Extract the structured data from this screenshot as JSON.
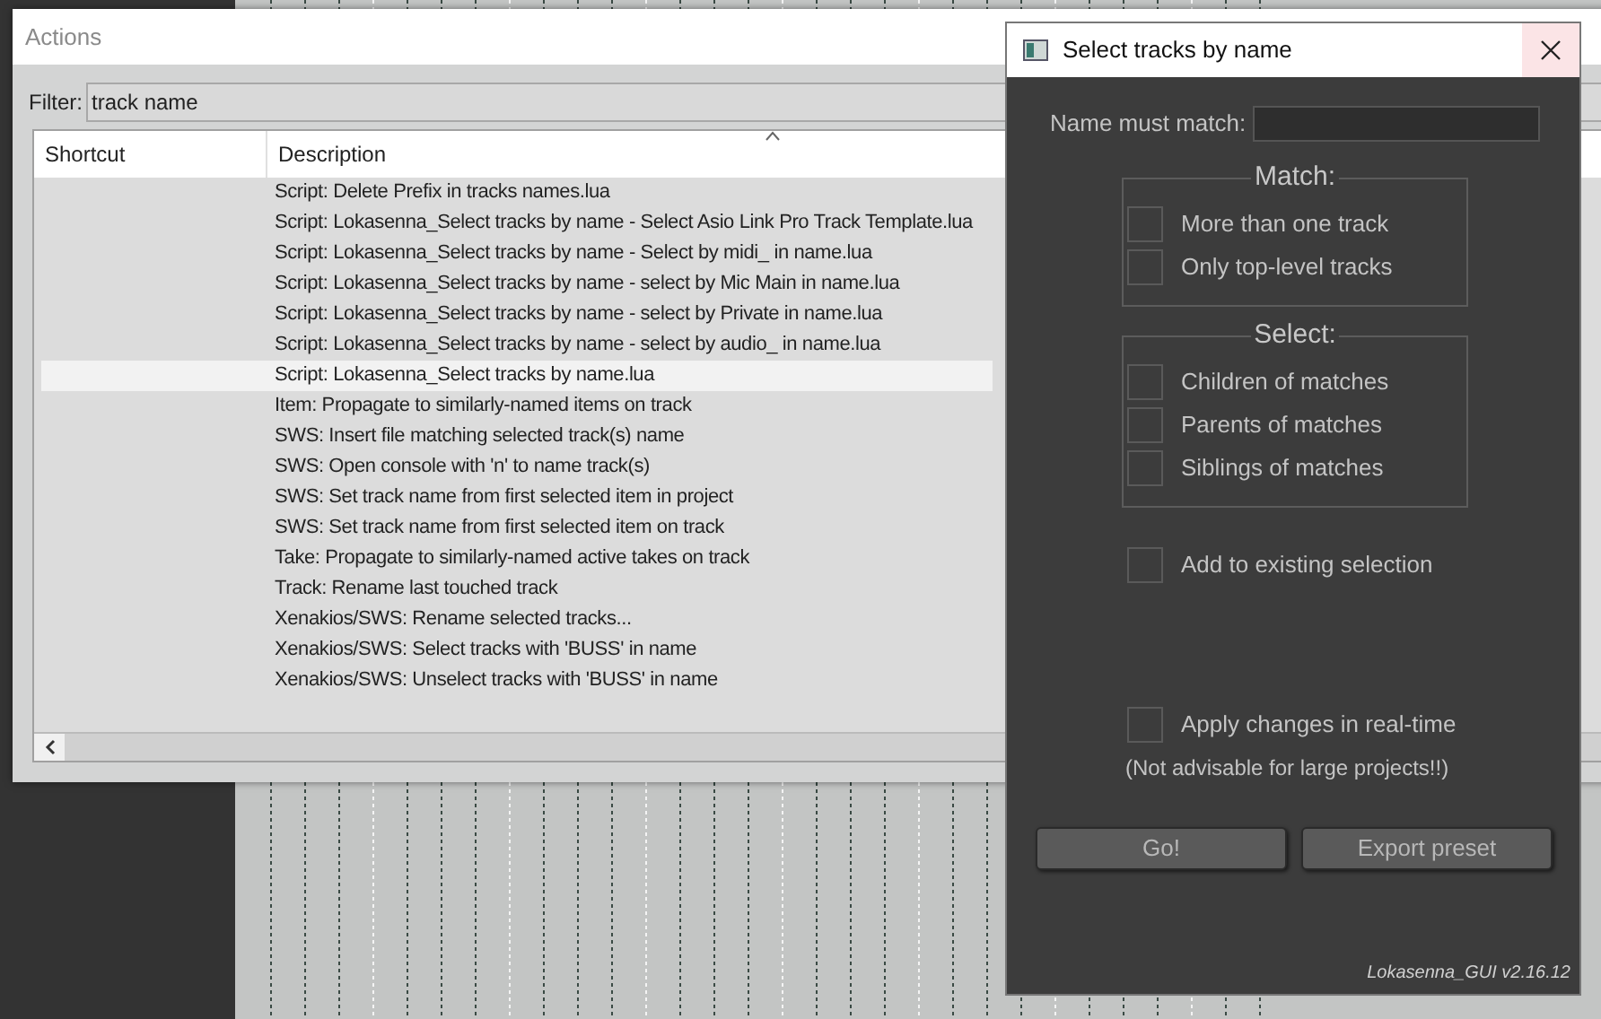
{
  "actions_window": {
    "title": "Actions",
    "filter": {
      "label": "Filter:",
      "value": "track name"
    },
    "columns": [
      "Shortcut",
      "Description"
    ],
    "rows": [
      {
        "description": "Script: Delete Prefix in tracks names.lua",
        "selected": false
      },
      {
        "description": "Script: Lokasenna_Select tracks by name - Select Asio Link Pro Track Template.lua",
        "selected": false
      },
      {
        "description": "Script: Lokasenna_Select tracks by name - Select by midi_ in name.lua",
        "selected": false
      },
      {
        "description": "Script: Lokasenna_Select tracks by name - select by Mic Main in name.lua",
        "selected": false
      },
      {
        "description": "Script: Lokasenna_Select tracks by name - select by Private in name.lua",
        "selected": false
      },
      {
        "description": "Script: Lokasenna_Select tracks by name - select by audio_ in name.lua",
        "selected": false
      },
      {
        "description": "Script: Lokasenna_Select tracks by name.lua",
        "selected": true
      },
      {
        "description": "Item: Propagate to similarly-named items on track",
        "selected": false
      },
      {
        "description": "SWS: Insert file matching selected track(s) name",
        "selected": false
      },
      {
        "description": "SWS: Open console with 'n' to name track(s)",
        "selected": false
      },
      {
        "description": "SWS: Set track name from first selected item in project",
        "selected": false
      },
      {
        "description": "SWS: Set track name from first selected item on track",
        "selected": false
      },
      {
        "description": "Take: Propagate to similarly-named active takes on track",
        "selected": false
      },
      {
        "description": "Track: Rename last touched track",
        "selected": false
      },
      {
        "description": "Xenakios/SWS: Rename selected tracks...",
        "selected": false
      },
      {
        "description": "Xenakios/SWS: Select tracks with 'BUSS' in name",
        "selected": false
      },
      {
        "description": "Xenakios/SWS: Unselect tracks with 'BUSS' in name",
        "selected": false
      }
    ]
  },
  "dialog": {
    "title": "Select tracks by name",
    "name_field": {
      "label": "Name must match:"
    },
    "groups": [
      {
        "title": "Match:",
        "options": [
          {
            "label": "More than one track",
            "checked": false
          },
          {
            "label": "Only top-level tracks",
            "checked": false
          }
        ]
      },
      {
        "title": "Select:",
        "options": [
          {
            "label": "Children of matches",
            "checked": false
          },
          {
            "label": "Parents of matches",
            "checked": false
          },
          {
            "label": "Siblings of matches",
            "checked": false
          }
        ]
      }
    ],
    "add_option": {
      "label": "Add to existing selection",
      "checked": false
    },
    "realtime_option": {
      "label": "Apply changes in real-time",
      "checked": false
    },
    "note": "(Not advisable for large projects!!)",
    "buttons": [
      "Go!",
      "Export preset"
    ],
    "version": "Lokasenna_GUI v2.16.12"
  }
}
